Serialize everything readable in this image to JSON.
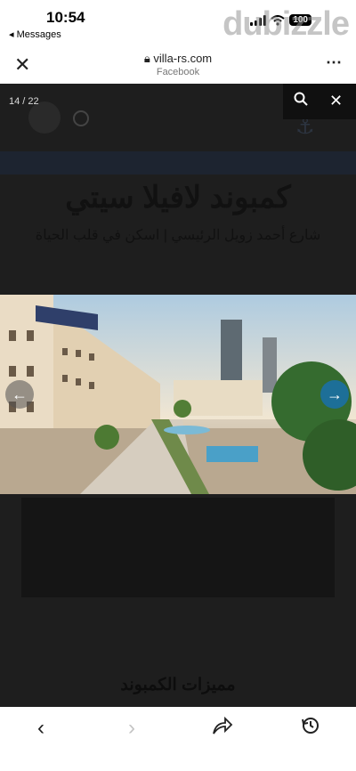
{
  "status_bar": {
    "time": "10:54",
    "back_label": "◂ Messages",
    "battery": "100"
  },
  "watermark": "dubizzle",
  "browser": {
    "url": "villa-rs.com",
    "site_label": "Facebook"
  },
  "gallery": {
    "counter": "14 / 22"
  },
  "page": {
    "heading": "كمبوند لافيلا سيتي",
    "subheading": "شارع أحمد زويل الرئيسي | اسكن في قلب الحياة",
    "features_heading": "مميزات الكمبوند"
  },
  "icons": {
    "close": "close-icon",
    "search": "search-icon",
    "lock": "lock-icon",
    "more": "more-icon",
    "prev": "arrow-left-icon",
    "next": "arrow-right-icon",
    "share": "share-icon",
    "history": "history-icon"
  },
  "colors": {
    "next_button": "#1d6f98",
    "overlay": "#1e1e1e"
  }
}
